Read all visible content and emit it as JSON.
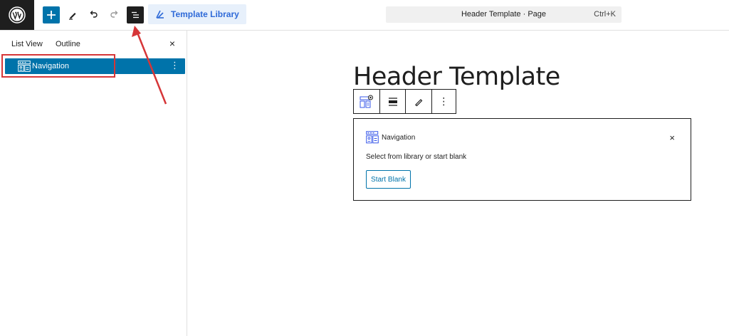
{
  "toolbar": {
    "template_library_label": "Template Library"
  },
  "command_bar": {
    "title": "Header Template · Page",
    "shortcut": "Ctrl+K"
  },
  "sidebar": {
    "tabs": [
      {
        "label": "List View"
      },
      {
        "label": "Outline"
      }
    ],
    "close_glyph": "×",
    "items": [
      {
        "label": "Navigation",
        "selected": true
      }
    ],
    "more_glyph": "⋮"
  },
  "canvas": {
    "page_title": "Header Template",
    "block_toolbar": {
      "more_glyph": "⋮"
    },
    "placeholder": {
      "title": "Navigation",
      "description": "Select from library or start blank",
      "start_blank_label": "Start Blank",
      "close_glyph": "×"
    }
  },
  "colors": {
    "accent": "#0073aa",
    "annotation_red": "#d63638",
    "dark": "#1e1e1e",
    "template_library_text": "#2f6ad8"
  },
  "icons": {
    "wordpress": "wordpress-logo-icon",
    "add": "plus-icon",
    "tools": "pencil-icon",
    "undo": "undo-icon",
    "redo": "redo-icon",
    "list_view": "list-view-icon",
    "template_library": "template-library-icon",
    "navigation": "navigation-block-icon",
    "align": "align-icon",
    "edit": "pencil-icon",
    "more": "more-vertical-icon",
    "close": "close-icon"
  }
}
